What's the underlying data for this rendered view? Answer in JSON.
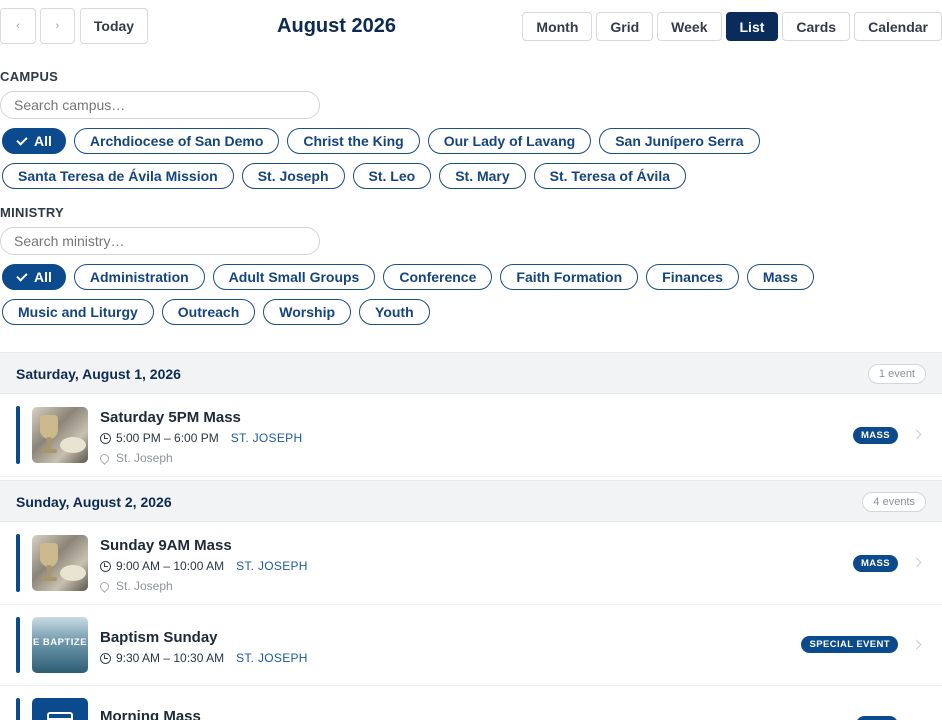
{
  "header": {
    "prev_label": "‹",
    "next_label": "›",
    "today_label": "Today",
    "month_title": "August 2026",
    "views": [
      {
        "label": "Month",
        "active": false
      },
      {
        "label": "Grid",
        "active": false
      },
      {
        "label": "Week",
        "active": false
      },
      {
        "label": "List",
        "active": true
      },
      {
        "label": "Cards",
        "active": false
      },
      {
        "label": "Calendar",
        "active": false
      }
    ]
  },
  "campus_filter": {
    "label": "CAMPUS",
    "placeholder": "Search campus…",
    "chips": [
      {
        "label": "All",
        "active": true
      },
      {
        "label": "Archdiocese of San Demo",
        "active": false
      },
      {
        "label": "Christ the King",
        "active": false
      },
      {
        "label": "Our Lady of Lavang",
        "active": false
      },
      {
        "label": "San Junípero Serra",
        "active": false
      },
      {
        "label": "Santa Teresa de Ávila Mission",
        "active": false
      },
      {
        "label": "St. Joseph",
        "active": false
      },
      {
        "label": "St. Leo",
        "active": false
      },
      {
        "label": "St. Mary",
        "active": false
      },
      {
        "label": "St. Teresa of Ávila",
        "active": false
      }
    ]
  },
  "ministry_filter": {
    "label": "MINISTRY",
    "placeholder": "Search ministry…",
    "chips": [
      {
        "label": "All",
        "active": true
      },
      {
        "label": "Administration",
        "active": false
      },
      {
        "label": "Adult Small Groups",
        "active": false
      },
      {
        "label": "Conference",
        "active": false
      },
      {
        "label": "Faith Formation",
        "active": false
      },
      {
        "label": "Finances",
        "active": false
      },
      {
        "label": "Mass",
        "active": false
      },
      {
        "label": "Music and Liturgy",
        "active": false
      },
      {
        "label": "Outreach",
        "active": false
      },
      {
        "label": "Worship",
        "active": false
      },
      {
        "label": "Youth",
        "active": false
      }
    ]
  },
  "days": [
    {
      "date": "Saturday, August 1, 2026",
      "count": "1 event",
      "events": [
        {
          "title": "Saturday 5PM Mass",
          "time": "5:00 PM – 6:00 PM",
          "campus": "ST. JOSEPH",
          "location": "St. Joseph",
          "tag": "MASS",
          "thumb": "mass-image"
        }
      ]
    },
    {
      "date": "Sunday, August 2, 2026",
      "count": "4 events",
      "events": [
        {
          "title": "Sunday 9AM Mass",
          "time": "9:00 AM – 10:00 AM",
          "campus": "ST. JOSEPH",
          "location": "St. Joseph",
          "tag": "MASS",
          "thumb": "mass-image"
        },
        {
          "title": "Baptism Sunday",
          "time": "9:30 AM – 10:30 AM",
          "campus": "ST. JOSEPH",
          "location": "",
          "tag": "SPECIAL EVENT",
          "thumb": "baptism-image",
          "thumb_text": "E BAPTIZE"
        },
        {
          "title": "Morning Mass",
          "time": "",
          "campus": "",
          "location": "",
          "tag": "",
          "thumb": "calendar-icon"
        }
      ]
    }
  ],
  "colors": {
    "primary": "#0b4a8c",
    "navy": "#0a2c5a",
    "day_header_bg": "#f2f3f5"
  }
}
